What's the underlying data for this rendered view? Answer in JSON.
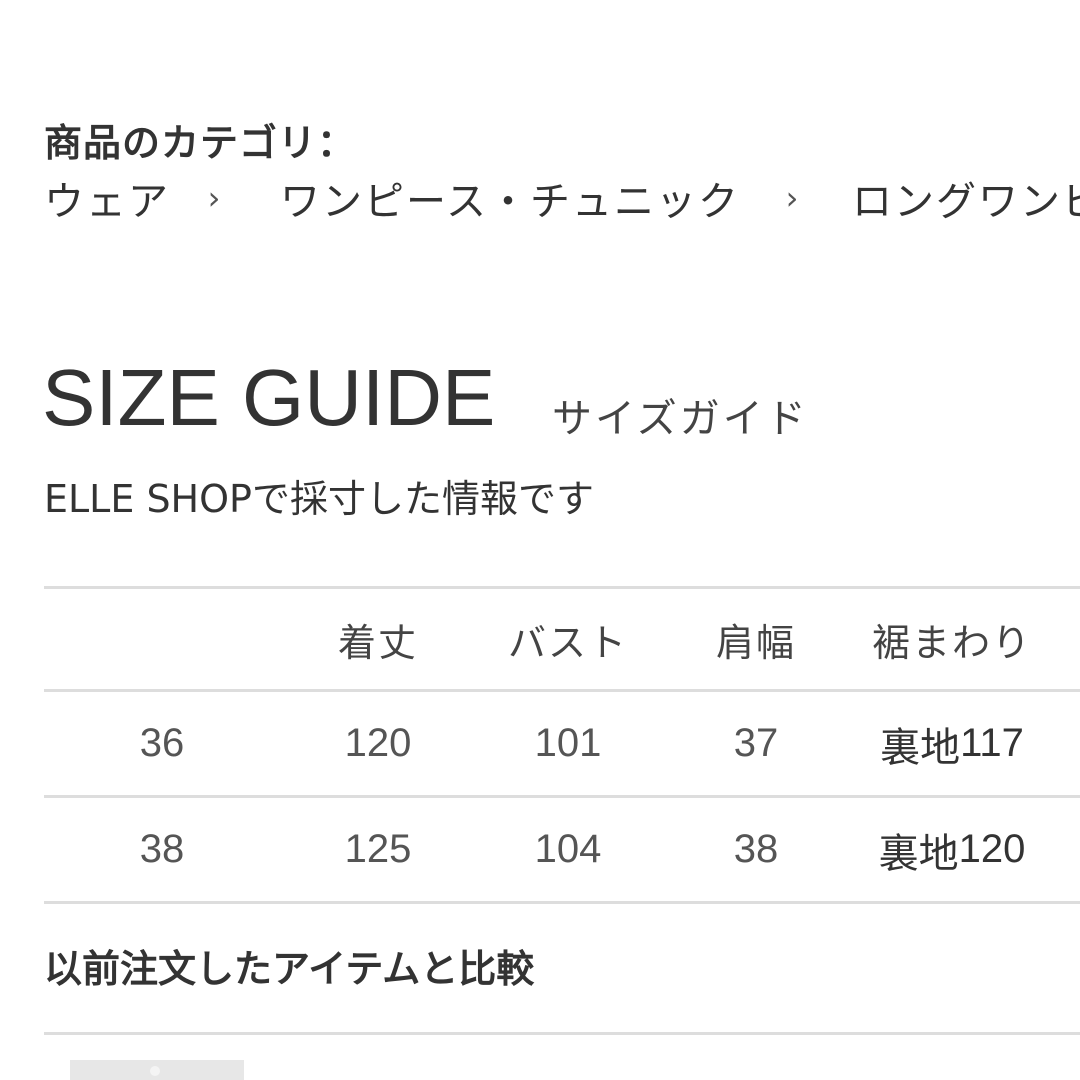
{
  "category": {
    "label": "商品のカテゴリ："
  },
  "breadcrumb": {
    "items": [
      "ウェア",
      "ワンピース・チュニック",
      "ロングワンピ"
    ],
    "separator": "›"
  },
  "size_guide": {
    "title": "SIZE GUIDE",
    "subtitle": "サイズガイド",
    "note": "ELLE SHOPで採寸した情報です"
  },
  "size_table": {
    "headers": [
      "",
      "着丈",
      "バスト",
      "肩幅",
      "裾まわり"
    ],
    "rows": [
      {
        "size": "36",
        "length": "120",
        "bust": "101",
        "shoulder": "37",
        "hem_prefix": "裏地",
        "hem_value": "117"
      },
      {
        "size": "38",
        "length": "125",
        "bust": "104",
        "shoulder": "38",
        "hem_prefix": "裏地",
        "hem_value": "120"
      }
    ]
  },
  "compare": {
    "title": "以前注文したアイテムと比較"
  },
  "colors": {
    "text": "#333333",
    "divider": "#dddddd",
    "background": "#ffffff"
  }
}
